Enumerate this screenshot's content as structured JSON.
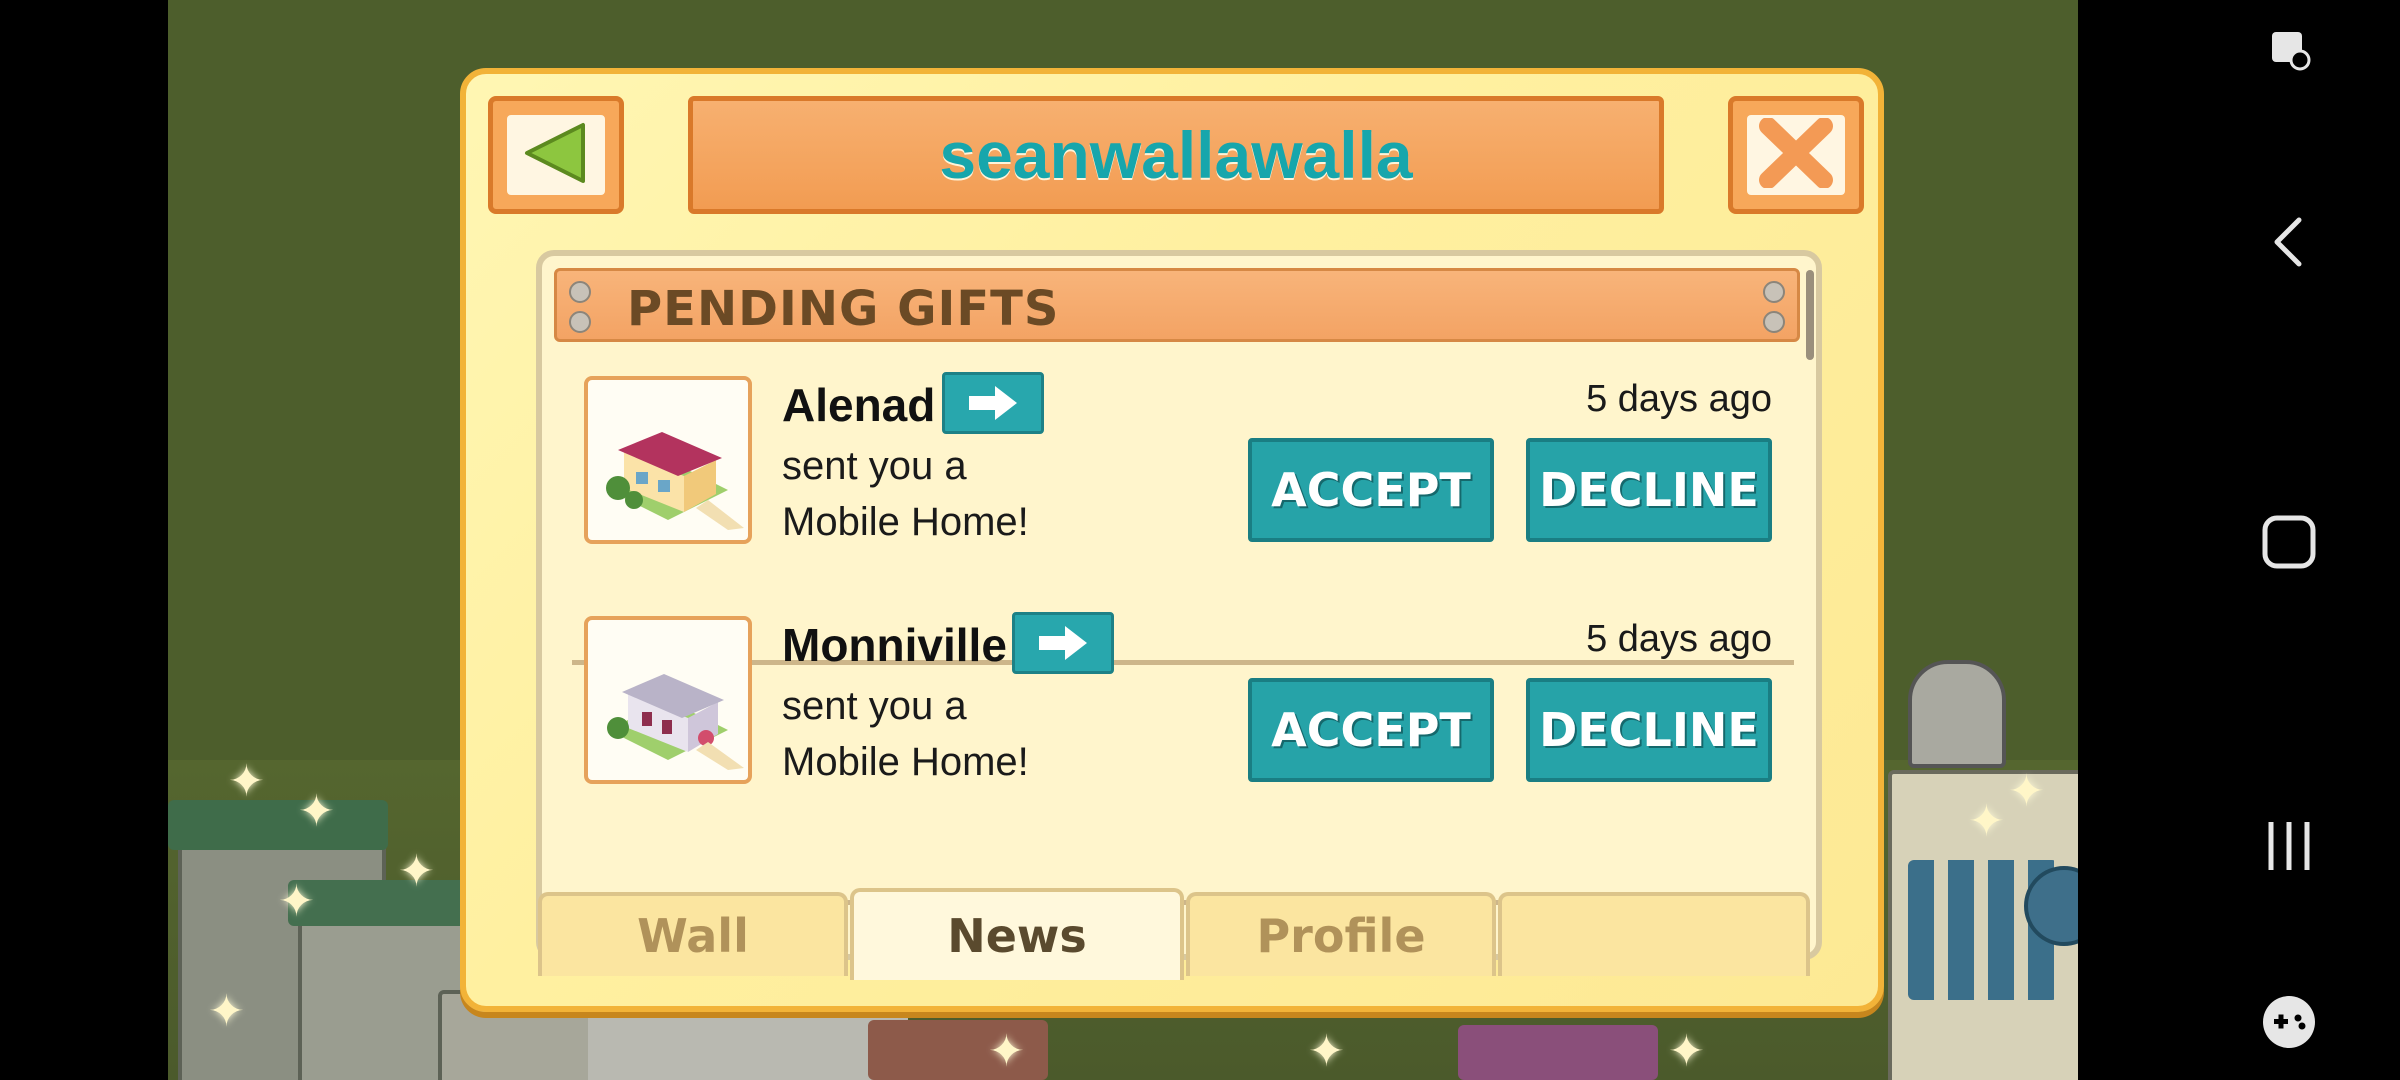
{
  "dialog": {
    "title": "seanwallawalla",
    "back_icon": "back-arrow-icon",
    "close_icon": "close-x-icon"
  },
  "section": {
    "title": "PENDING GIFTS"
  },
  "gifts": [
    {
      "sender": "Alenad",
      "message_line1": "sent you a",
      "message_line2": "Mobile Home!",
      "time": "5 days ago",
      "accept_label": "ACCEPT",
      "decline_label": "DECLINE"
    },
    {
      "sender": "Monniville",
      "message_line1": "sent you a",
      "message_line2": "Mobile Home!",
      "time": "5 days ago",
      "accept_label": "ACCEPT",
      "decline_label": "DECLINE"
    }
  ],
  "tabs": [
    {
      "label": "Wall",
      "active": false
    },
    {
      "label": "News",
      "active": true
    },
    {
      "label": "Profile",
      "active": false
    },
    {
      "label": "",
      "active": false
    }
  ],
  "colors": {
    "title_text": "#17a6ac",
    "action_button": "#26a3a8",
    "dialog_border": "#f2b338"
  }
}
